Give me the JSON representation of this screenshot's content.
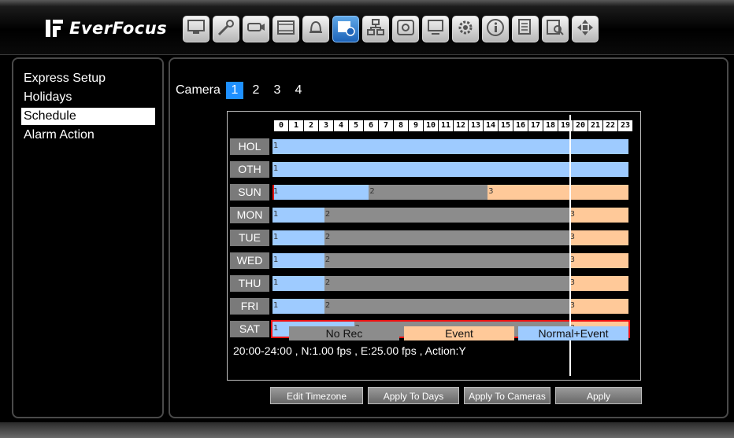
{
  "app": {
    "brand": "EverFocus"
  },
  "toolbar": {
    "icons": [
      "monitor-icon",
      "tools-icon",
      "camera-icon",
      "film-icon",
      "alarm-icon",
      "schedule-icon",
      "network-icon",
      "disk-icon",
      "display-icon",
      "system-settings-icon",
      "info-icon",
      "log-icon",
      "search-playback-icon",
      "ptz-icon"
    ],
    "active_index": 5
  },
  "menu": {
    "items": [
      "Express Setup",
      "Holidays",
      "Schedule",
      "Alarm Action"
    ],
    "selected": "Schedule"
  },
  "camera": {
    "label": "Camera",
    "numbers": [
      "1",
      "2",
      "3",
      "4"
    ],
    "selected": "1"
  },
  "hours": [
    "0",
    "1",
    "2",
    "3",
    "4",
    "5",
    "6",
    "7",
    "8",
    "9",
    "10",
    "11",
    "12",
    "13",
    "14",
    "15",
    "16",
    "17",
    "18",
    "19",
    "20",
    "21",
    "22",
    "23"
  ],
  "colors": {
    "normal_event": "#9ecbff",
    "no_rec": "#8c8c8c",
    "event": "#ffc999",
    "selected_outline": "#e11111",
    "camera_active": "#1e90ff"
  },
  "schedule": [
    {
      "day": "HOL",
      "segments": [
        {
          "label": "1",
          "start": 0,
          "end": 24,
          "type": "normal_event"
        }
      ]
    },
    {
      "day": "OTH",
      "segments": [
        {
          "label": "1",
          "start": 0,
          "end": 24,
          "type": "normal_event"
        }
      ]
    },
    {
      "day": "SUN",
      "segments": [
        {
          "label": "1",
          "start": 0,
          "end": 6.5,
          "type": "normal_event"
        },
        {
          "label": "2",
          "start": 6.5,
          "end": 14.5,
          "type": "no_rec"
        },
        {
          "label": "3",
          "start": 14.5,
          "end": 24,
          "type": "event"
        }
      ],
      "first_highlight": true
    },
    {
      "day": "MON",
      "segments": [
        {
          "label": "1",
          "start": 0,
          "end": 3.5,
          "type": "normal_event"
        },
        {
          "label": "2",
          "start": 3.5,
          "end": 20,
          "type": "no_rec"
        },
        {
          "label": "3",
          "start": 20,
          "end": 24,
          "type": "event"
        }
      ]
    },
    {
      "day": "TUE",
      "segments": [
        {
          "label": "1",
          "start": 0,
          "end": 3.5,
          "type": "normal_event"
        },
        {
          "label": "2",
          "start": 3.5,
          "end": 20,
          "type": "no_rec"
        },
        {
          "label": "3",
          "start": 20,
          "end": 24,
          "type": "event"
        }
      ]
    },
    {
      "day": "WED",
      "segments": [
        {
          "label": "1",
          "start": 0,
          "end": 3.5,
          "type": "normal_event"
        },
        {
          "label": "2",
          "start": 3.5,
          "end": 20,
          "type": "no_rec"
        },
        {
          "label": "3",
          "start": 20,
          "end": 24,
          "type": "event"
        }
      ]
    },
    {
      "day": "THU",
      "segments": [
        {
          "label": "1",
          "start": 0,
          "end": 3.5,
          "type": "normal_event"
        },
        {
          "label": "2",
          "start": 3.5,
          "end": 20,
          "type": "no_rec"
        },
        {
          "label": "3",
          "start": 20,
          "end": 24,
          "type": "event"
        }
      ]
    },
    {
      "day": "FRI",
      "segments": [
        {
          "label": "1",
          "start": 0,
          "end": 3.5,
          "type": "normal_event"
        },
        {
          "label": "2",
          "start": 3.5,
          "end": 20,
          "type": "no_rec"
        },
        {
          "label": "3",
          "start": 20,
          "end": 24,
          "type": "event"
        }
      ]
    },
    {
      "day": "SAT",
      "segments": [
        {
          "label": "1",
          "start": 0,
          "end": 5.5,
          "type": "normal_event"
        },
        {
          "label": "2",
          "start": 5.5,
          "end": 20,
          "type": "no_rec"
        },
        {
          "label": "3",
          "start": 20,
          "end": 24,
          "type": "event"
        }
      ],
      "selected": true
    }
  ],
  "cursor_hour": 20,
  "legend": {
    "no_rec": "No Rec",
    "event": "Event",
    "normal_event": "Normal+Event"
  },
  "info_text": "20:00-24:00 , N:1.00 fps , E:25.00 fps , Action:Y",
  "buttons": {
    "edit_timezone": "Edit Timezone",
    "apply_to_days": "Apply To Days",
    "apply_to_cameras": "Apply To Cameras",
    "apply": "Apply"
  }
}
